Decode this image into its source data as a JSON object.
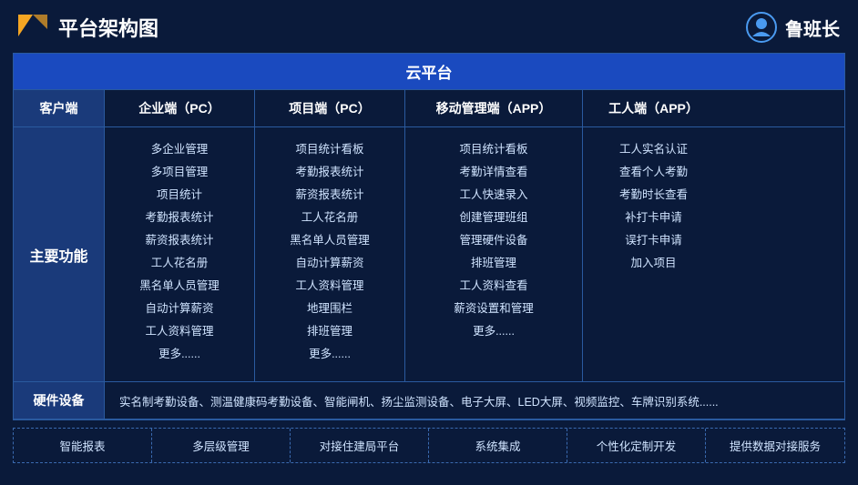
{
  "header": {
    "title": "平台架构图",
    "brand": "鲁班长"
  },
  "cloud_platform": {
    "label": "云平台"
  },
  "columns": [
    {
      "id": "client",
      "label": "客户端"
    },
    {
      "id": "enterprise",
      "label": "企业端（PC）"
    },
    {
      "id": "project",
      "label": "项目端（PC）"
    },
    {
      "id": "mobile",
      "label": "移动管理端（APP）"
    },
    {
      "id": "worker",
      "label": "工人端（APP）"
    }
  ],
  "row_label": "主要功能",
  "enterprise_funcs": [
    "多企业管理",
    "多项目管理",
    "项目统计",
    "考勤报表统计",
    "薪资报表统计",
    "工人花名册",
    "黑名单人员管理",
    "自动计算薪资",
    "工人资料管理",
    "更多......"
  ],
  "project_funcs": [
    "项目统计看板",
    "考勤报表统计",
    "薪资报表统计",
    "工人花名册",
    "黑名单人员管理",
    "自动计算薪资",
    "工人资料管理",
    "地理围栏",
    "排班管理",
    "更多......"
  ],
  "mobile_funcs": [
    "项目统计看板",
    "考勤详情查看",
    "工人快速录入",
    "创建管理班组",
    "管理硬件设备",
    "排班管理",
    "工人资料查看",
    "薪资设置和管理",
    "更多......"
  ],
  "worker_funcs": [
    "工人实名认证",
    "查看个人考勤",
    "考勤时长查看",
    "补打卡申请",
    "误打卡申请",
    "加入项目"
  ],
  "hardware": {
    "label": "硬件设备",
    "content": "实名制考勤设备、测温健康码考勤设备、智能闸机、扬尘监测设备、电子大屏、LED大屏、视频监控、车牌识别系统......"
  },
  "features": [
    "智能报表",
    "多层级管理",
    "对接住建局平台",
    "系统集成",
    "个性化定制开发",
    "提供数据对接服务"
  ]
}
